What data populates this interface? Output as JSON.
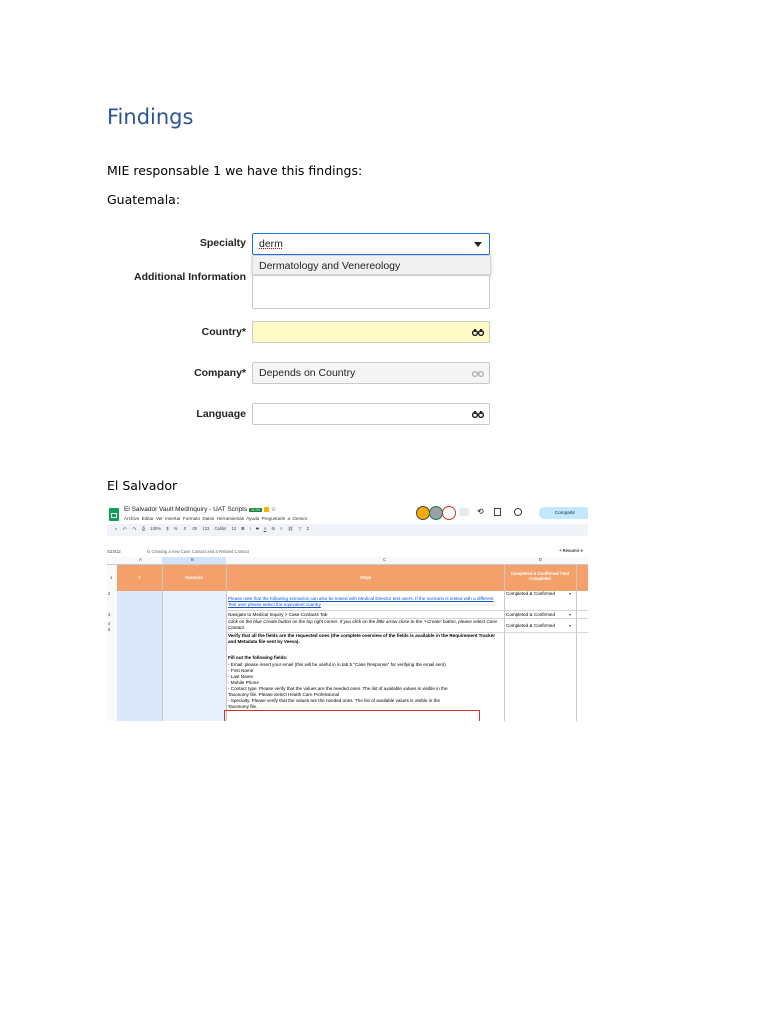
{
  "heading": "Findings",
  "intro": "MIE responsable 1 we have this findings:",
  "section_guatemala": "Guatemala:",
  "form": {
    "specialty_label": "Specialty",
    "specialty_value": "derm",
    "specialty_option": "Dermatology and Venereology",
    "additional_label": "Additional Information",
    "country_label": "Country*",
    "company_label": "Company*",
    "company_value": "Depends on Country",
    "language_label": "Language",
    "icons": [
      "chevron-down-icon",
      "binoculars-icon"
    ],
    "colors": {
      "focus_border": "#1a73e8",
      "country_bg": "#fffbc7",
      "company_bg": "#f5f5f5"
    }
  },
  "section_el_salvador": "El Salvador",
  "sheet": {
    "doc_title": "El Salvador Vault MedInquiry - UAT Scripts",
    "badge": "XLSX",
    "menu": [
      "Archivo",
      "Editar",
      "Ver",
      "Insertar",
      "Formato",
      "Datos",
      "Herramientas",
      "Ayuda",
      "Preguntarle a Gemini"
    ],
    "toolbar": [
      "100%",
      "$",
      "%",
      ".0",
      ".00",
      "123",
      "Calibri",
      "12"
    ],
    "share_label": "Compartir",
    "cell_ref": "S3:B12",
    "formula": "Creating a new Case Contact and a Related Contact",
    "resume_label": "+ Resumir e",
    "col_letters": [
      "A",
      "B",
      "C",
      "D"
    ],
    "row_numbers": [
      "1",
      "2",
      "3",
      "4",
      "5"
    ],
    "headers": {
      "num": "#",
      "scenario": "Scenario",
      "steps": "Steps",
      "status": "Completed & Confirmed / Not Completed"
    },
    "rows": [
      {
        "step_link": "Please note that the following scenarios can also be tested with Medical Director test users. If the scenario is tested with a different Test user please select the equivalent country",
        "status": "Completed & Confirmed"
      },
      {
        "step": "Navigate to Medical Inquiry > Case Contacts Tab",
        "status": "Completed & Confirmed"
      },
      {
        "step": "Click on the blue Create button on the top right corner. If you click on the little arrow close to the '+Create' button, please select Case Contact.",
        "status": "Completed & Confirmed"
      }
    ],
    "step_block": {
      "verify": "Verify that all the fields are the requested ones (the complete overview of the fields is available in the Requirement Tracker and Metadata file sent by Veeva).",
      "fill": "Fill out the following fields:",
      "lines": [
        "- Email: please insert your email (this will be useful in in tab 5 \"Case Response\" for verifying the email sent)",
        "- First Name",
        "- Last Name",
        "- Mobile Phone",
        "- Contact type. Please verify that the values are the needed ones. The list of available values is visible in the",
        "Taxonomy file. Please Select Health Care Professional",
        "- Specialty. Please verify that the values are the needed ones. The list of available values is visible in the",
        "Taxonomy file."
      ]
    }
  }
}
